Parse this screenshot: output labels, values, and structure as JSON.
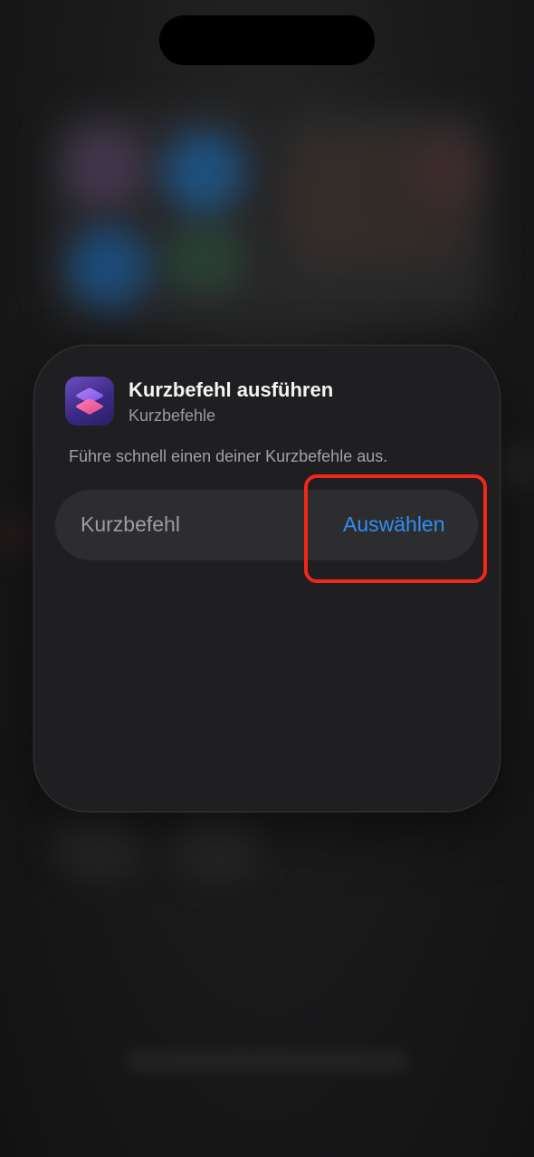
{
  "widget": {
    "app_icon": "shortcuts-app-icon",
    "title": "Kurzbefehl ausführen",
    "app_name": "Kurzbefehle",
    "description": "Führe schnell einen deiner Kurzbefehle aus.",
    "parameter": {
      "label": "Kurzbefehl",
      "action_label": "Auswählen"
    }
  },
  "colors": {
    "accent_blue": "#2f8ff6",
    "highlight_red": "#f1271a",
    "card_background": "#1f1f21"
  }
}
